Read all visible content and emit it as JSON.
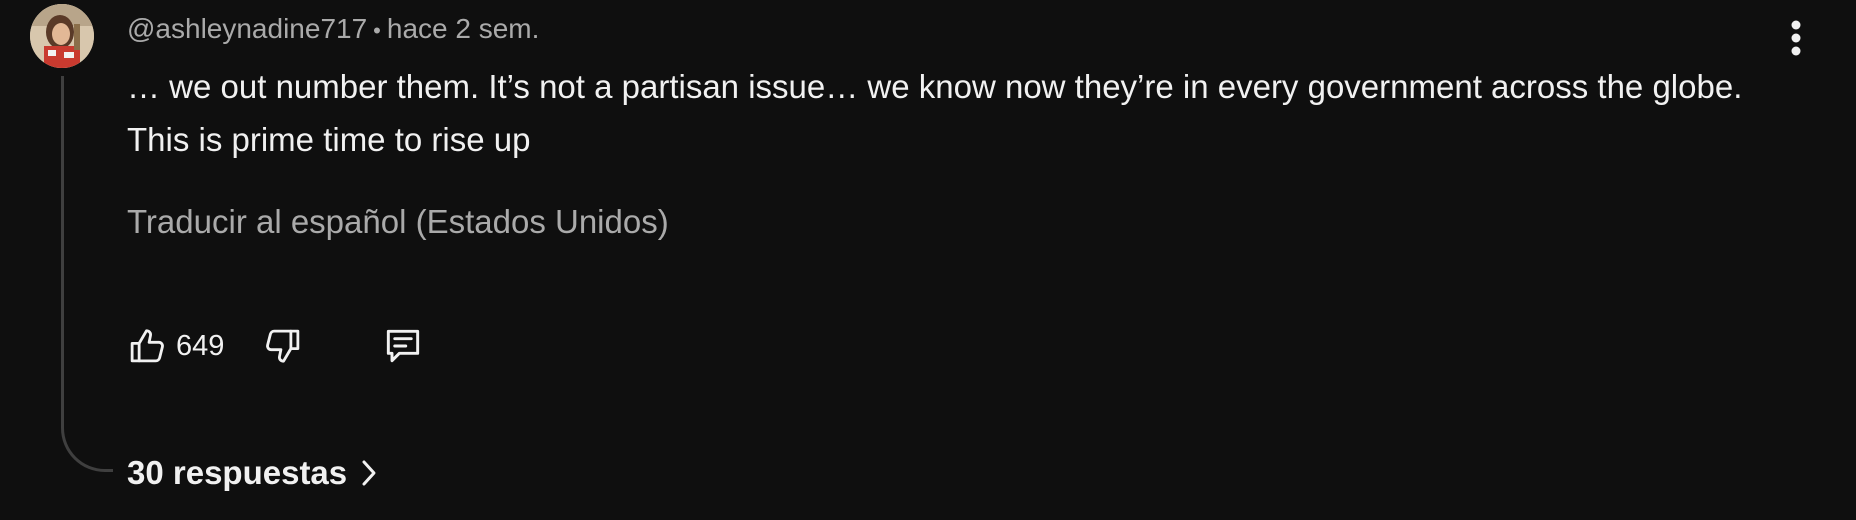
{
  "comment": {
    "author": "@ashleynadine717",
    "separator": "•",
    "timestamp": "hace 2 sem.",
    "text": "… we out number them. It’s not a partisan issue… we know now they’re in every government across the globe. This is prime time to rise up",
    "translate_label": "Traducir al español (Estados Unidos)",
    "like_count": "649",
    "replies_label": "30 respuestas"
  },
  "icons": {
    "avatar": "avatar",
    "like": "thumb-up-icon",
    "dislike": "thumb-down-icon",
    "reply": "reply-comment-icon",
    "menu": "more-vert-icon",
    "replies_chevron": "chevron-right-icon"
  },
  "colors": {
    "background": "#0f0f0f",
    "primary_text": "#f1f1f1",
    "secondary_text": "#aaaaaa",
    "thread_line": "#3f3f3f"
  }
}
